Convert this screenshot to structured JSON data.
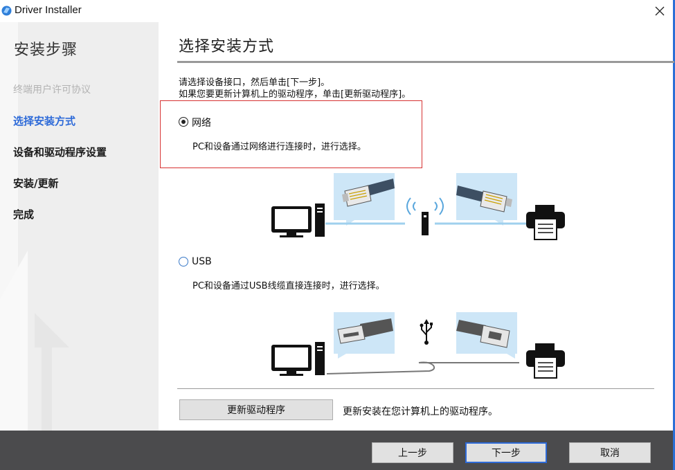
{
  "window": {
    "title": "Driver Installer"
  },
  "sidebar": {
    "title": "安装步骤",
    "steps": [
      {
        "label": "终端用户许可协议",
        "state": "done"
      },
      {
        "label": "选择安装方式",
        "state": "active"
      },
      {
        "label": "设备和驱动程序设置",
        "state": "pending"
      },
      {
        "label": "安装/更新",
        "state": "pending"
      },
      {
        "label": "完成",
        "state": "pending"
      }
    ]
  },
  "main": {
    "title": "选择安装方式",
    "instructions": [
      "请选择设备接口，然后单击[下一步]。",
      "如果您要更新计算机上的驱动程序，单击[更新驱动程序]。"
    ],
    "options": [
      {
        "label": "网络",
        "selected": true,
        "description": "PC和设备通过网络进行连接时，进行选择。",
        "icon": "network-connection-illustration"
      },
      {
        "label": "USB",
        "selected": false,
        "description": "PC和设备通过USB线缆直接连接时，进行选择。",
        "icon": "usb-connection-illustration"
      }
    ],
    "update_button": "更新驱动程序",
    "update_description": "更新安装在您计算机上的驱动程序。"
  },
  "footer": {
    "back_label": "上一步",
    "next_label": "下一步",
    "cancel_label": "取消"
  },
  "colors": {
    "accent": "#2d6ad8",
    "highlight_box": "#d63030",
    "footer_bg": "#4b4b4d",
    "sidebar_bg": "#eeeeee",
    "illustration_panel": "#cde6f7"
  }
}
